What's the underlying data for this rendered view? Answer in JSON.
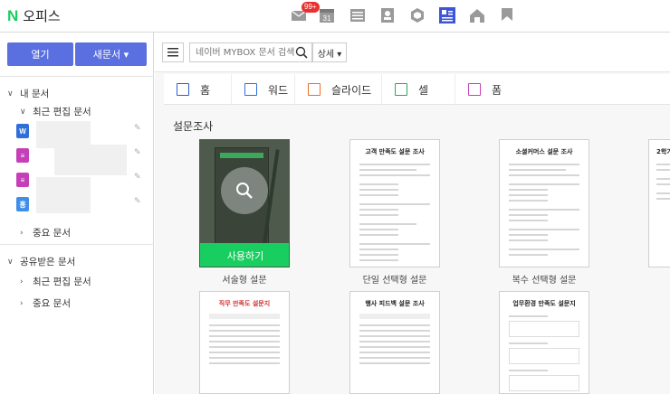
{
  "brand": {
    "logo_letter": "N",
    "title": "오피스",
    "accent": "#19ce60"
  },
  "topbar": {
    "mail_badge": "99+",
    "apps": [
      {
        "name": "mail-icon"
      },
      {
        "name": "calendar-icon",
        "text": "31"
      },
      {
        "name": "list-icon"
      },
      {
        "name": "contacts-icon"
      },
      {
        "name": "cube-icon"
      },
      {
        "name": "office-icon",
        "active": true
      },
      {
        "name": "home-icon"
      },
      {
        "name": "flag-icon"
      }
    ]
  },
  "sidebar": {
    "open_label": "열기",
    "new_label": "새문서 ▾",
    "my_docs": "내 문서",
    "recent": "최근 편집 문서",
    "doc_icons": [
      {
        "letter": "W",
        "color": "#2f6fd8"
      },
      {
        "letter": "≡",
        "color": "#c540b8"
      },
      {
        "letter": "≡",
        "color": "#c540b8"
      },
      {
        "letter": "흥",
        "color": "#3f8ee8"
      }
    ],
    "important": "중요 문서",
    "shared": "공유받은 문서",
    "shared_recent": "최근 편집 문서",
    "shared_important": "중요 문서"
  },
  "toolbar": {
    "search_placeholder": "네이버 MYBOX 문서 검색",
    "detail_label": "상세 ▾"
  },
  "tabs": [
    {
      "label": "홈",
      "color": "#2f5fc8"
    },
    {
      "label": "워드",
      "color": "#2f6fd8"
    },
    {
      "label": "슬라이드",
      "color": "#e8702a"
    },
    {
      "label": "셀",
      "color": "#1fae55"
    },
    {
      "label": "폼",
      "color": "#c540b8"
    }
  ],
  "section_title": "설문조사",
  "templates": [
    {
      "title": "",
      "caption": "서술형 설문",
      "cta": "사용하기"
    },
    {
      "title": "고객 만족도 설문 조사",
      "caption": "단일 선택형 설문"
    },
    {
      "title": "소셜커머스 설문 조사",
      "caption": "복수 선택형 설문"
    },
    {
      "title": "2학기",
      "caption": ""
    },
    {
      "title": "직무 만족도 설문지",
      "caption": ""
    },
    {
      "title": "행사 피드백 설문 조사",
      "caption": ""
    },
    {
      "title": "업무환경 만족도 설문지",
      "caption": ""
    }
  ]
}
